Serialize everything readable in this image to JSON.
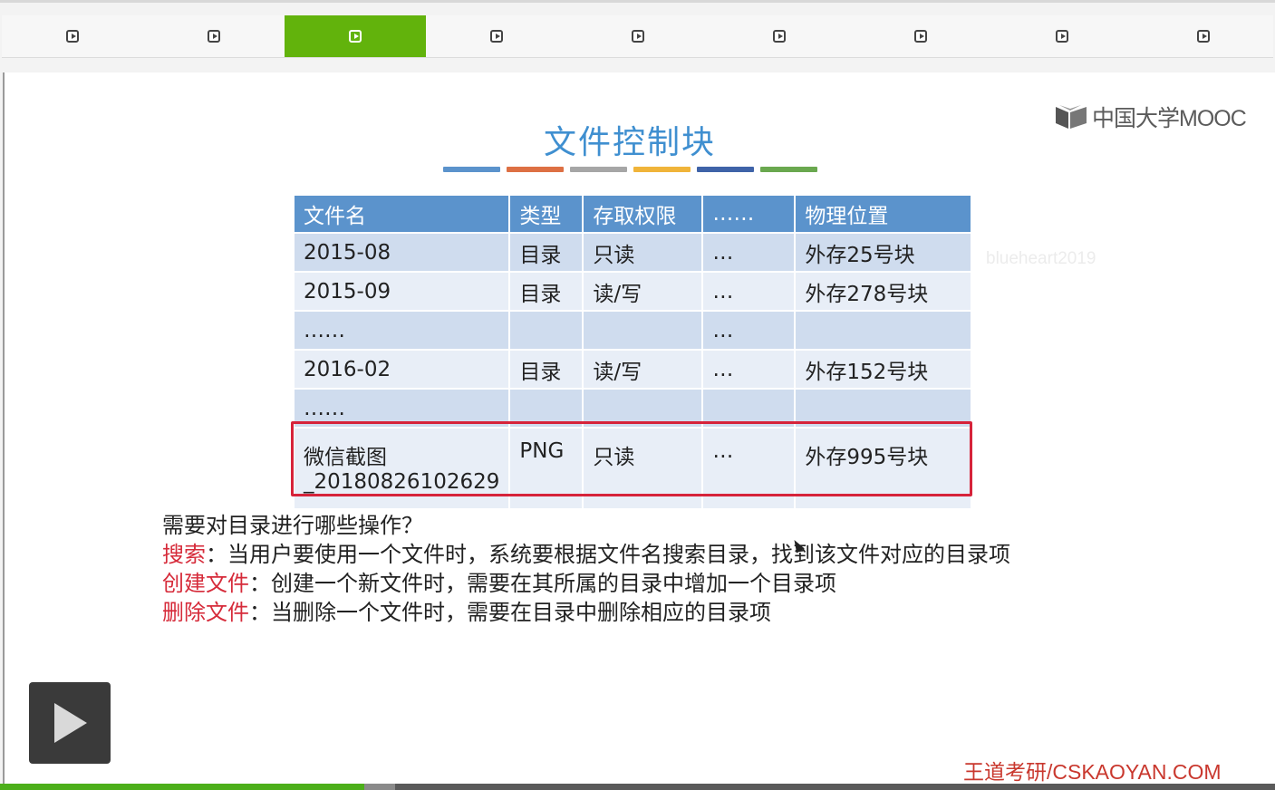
{
  "tabs": {
    "count": 9,
    "active_index": 2
  },
  "slide": {
    "logo": {
      "text": "中国大学MOOC"
    },
    "title": "文件控制块",
    "title_bar_colors": [
      "#5b93cc",
      "#dd7044",
      "#a6a6a6",
      "#f0b43a",
      "#3f63a8",
      "#6aa84f"
    ],
    "watermark": "blueheart2019",
    "table": {
      "headers": [
        "文件名",
        "类型",
        "存取权限",
        "……",
        "物理位置"
      ],
      "rows": [
        [
          "2015-08",
          "目录",
          "只读",
          "…",
          "外存25号块"
        ],
        [
          "2015-09",
          "目录",
          "读/写",
          "…",
          "外存278号块"
        ],
        [
          "……",
          "",
          "",
          "…",
          ""
        ],
        [
          "2016-02",
          "目录",
          "读/写",
          "…",
          "外存152号块"
        ],
        [
          "……",
          "",
          "",
          "",
          ""
        ],
        [
          "微信截图_20180826102629",
          "PNG",
          "只读",
          "…",
          "外存995号块"
        ]
      ],
      "last_row_name_line1": "微信截图",
      "last_row_name_line2": "_20180826102629"
    },
    "notes": {
      "question": "需要对目录进行哪些操作？",
      "items": [
        {
          "keyword": "搜索",
          "text": "：当用户要使用一个文件时，系统要根据文件名搜索目录，找到该文件对应的目录项"
        },
        {
          "keyword": "创建文件",
          "text": "：创建一个新文件时，需要在其所属的目录中增加一个目录项"
        },
        {
          "keyword": "删除文件",
          "text": "：当删除一个文件时，需要在目录中删除相应的目录项"
        }
      ]
    },
    "brand": "王道考研/CSKAOYAN.COM"
  },
  "player": {
    "progress": 0.286,
    "buffered": 0.31
  }
}
